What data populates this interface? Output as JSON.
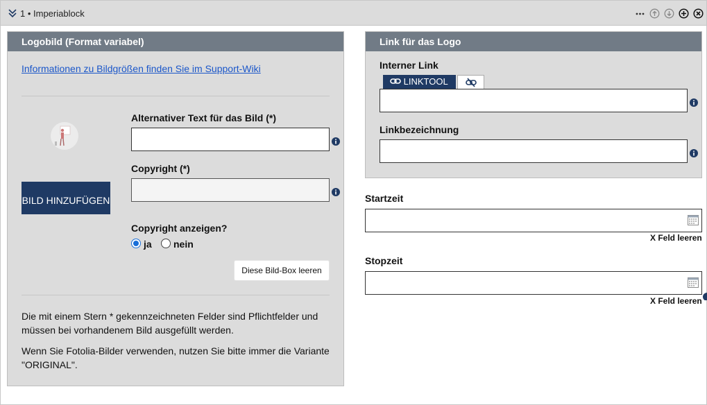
{
  "window": {
    "title": "1 • Imperiablock",
    "icons": [
      "collapse-icon",
      "more-icon",
      "move-up-icon",
      "move-down-icon",
      "add-icon",
      "remove-icon"
    ]
  },
  "logo_panel": {
    "header": "Logobild (Format variabel)",
    "support_link": "Informationen zu Bildgrößen finden Sie im Support-Wiki",
    "add_image_button": "BILD HINZUFÜGEN",
    "alt_text_label": "Alternativer Text für das Bild (*)",
    "alt_text_value": "",
    "copyright_label": "Copyright (*)",
    "copyright_value": "",
    "show_copyright_label": "Copyright anzeigen?",
    "show_copyright_options": [
      {
        "label": "ja",
        "selected": true
      },
      {
        "label": "nein",
        "selected": false
      }
    ],
    "clear_box_button": "Diese Bild-Box leeren",
    "note_1": "Die mit einem Stern * gekennzeichneten Felder sind Pflichtfelder und müssen bei vorhandenem Bild ausgefüllt werden.",
    "note_2": "Wenn Sie Fotolia-Bilder verwenden, nutzen Sie bitte immer die Variante \"ORIGINAL\"."
  },
  "link_panel": {
    "header": "Link für das Logo",
    "internal_link_label": "Interner Link",
    "linktool_tab": "LINKTOOL",
    "internal_link_value": "",
    "link_title_label": "Linkbezeichnung",
    "link_title_value": ""
  },
  "schedule": {
    "start_label": "Startzeit",
    "start_value": "",
    "stop_label": "Stopzeit",
    "stop_value": "",
    "clear_label": "X Feld leeren"
  },
  "colors": {
    "panel_header": "#717b86",
    "panel_bg": "#dcdcdc",
    "primary_button": "#1f3a64",
    "link": "#1a56c9",
    "info_icon": "#1f3a64"
  }
}
